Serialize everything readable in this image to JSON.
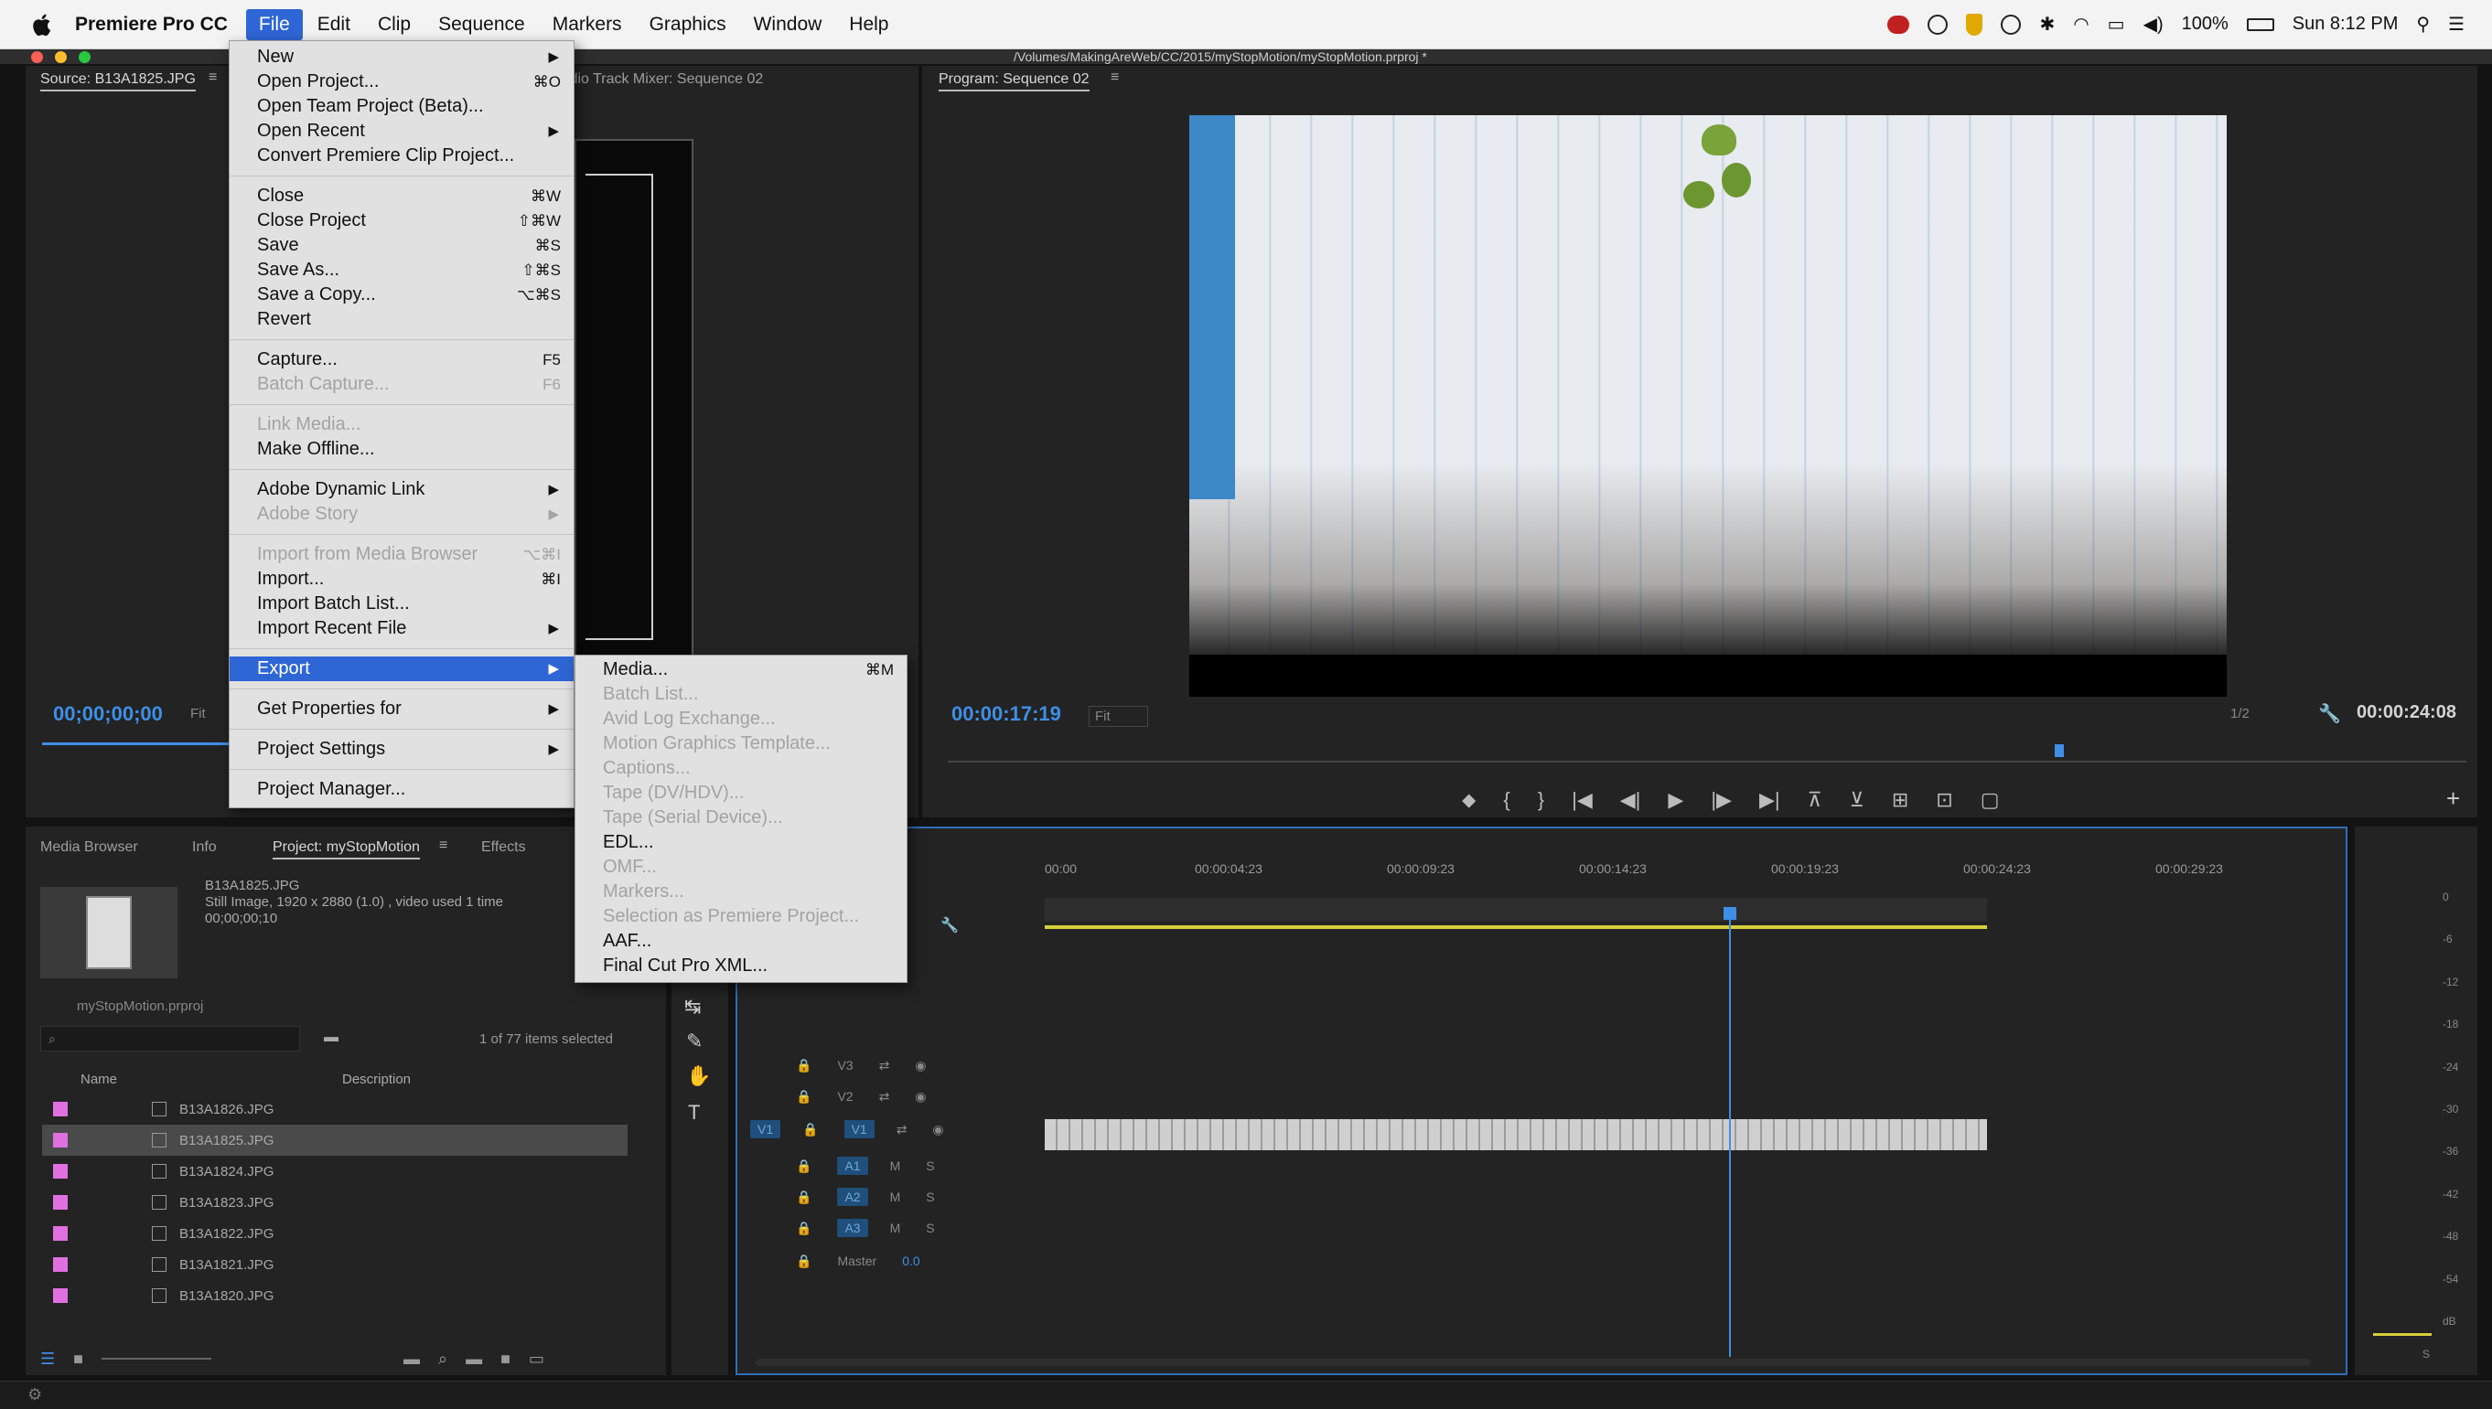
{
  "menubar": {
    "app_name": "Premiere Pro CC",
    "items": [
      "File",
      "Edit",
      "Clip",
      "Sequence",
      "Markers",
      "Graphics",
      "Window",
      "Help"
    ],
    "status": {
      "battery": "100%",
      "clock": "Sun 8:12 PM"
    }
  },
  "window": {
    "path": "/Volumes/MakingAreWeb/CC/2015/myStopMotion/myStopMotion.prproj *"
  },
  "source_panel": {
    "tab_source": "Source: B13A1825.JPG",
    "tab_mixer": "Audio Track Mixer: Sequence 02",
    "timecode": "00;00;00;00",
    "fit": "Fit"
  },
  "program_panel": {
    "tab": "Program: Sequence 02",
    "timecode": "00:00:17:19",
    "fit": "Fit",
    "zoom": "1/2",
    "duration": "00:00:24:08"
  },
  "file_menu": {
    "items": [
      {
        "label": "New",
        "arrow": true
      },
      {
        "label": "Open Project...",
        "shortcut": "⌘O"
      },
      {
        "label": "Open Team Project (Beta)..."
      },
      {
        "label": "Open Recent",
        "arrow": true
      },
      {
        "label": "Convert Premiere Clip Project..."
      },
      {
        "sep": true
      },
      {
        "label": "Close",
        "shortcut": "⌘W"
      },
      {
        "label": "Close Project",
        "shortcut": "⇧⌘W"
      },
      {
        "label": "Save",
        "shortcut": "⌘S"
      },
      {
        "label": "Save As...",
        "shortcut": "⇧⌘S"
      },
      {
        "label": "Save a Copy...",
        "shortcut": "⌥⌘S"
      },
      {
        "label": "Revert"
      },
      {
        "sep": true
      },
      {
        "label": "Capture...",
        "shortcut": "F5"
      },
      {
        "label": "Batch Capture...",
        "shortcut": "F6",
        "disabled": true
      },
      {
        "sep": true
      },
      {
        "label": "Link Media...",
        "disabled": true
      },
      {
        "label": "Make Offline..."
      },
      {
        "sep": true
      },
      {
        "label": "Adobe Dynamic Link",
        "arrow": true
      },
      {
        "label": "Adobe Story",
        "arrow": true,
        "disabled": true
      },
      {
        "sep": true
      },
      {
        "label": "Import from Media Browser",
        "shortcut": "⌥⌘I",
        "disabled": true
      },
      {
        "label": "Import...",
        "shortcut": "⌘I"
      },
      {
        "label": "Import Batch List..."
      },
      {
        "label": "Import Recent File",
        "arrow": true
      },
      {
        "sep": true
      },
      {
        "label": "Export",
        "arrow": true,
        "highlighted": true
      },
      {
        "sep": true
      },
      {
        "label": "Get Properties for",
        "arrow": true
      },
      {
        "sep": true
      },
      {
        "label": "Project Settings",
        "arrow": true
      },
      {
        "sep": true
      },
      {
        "label": "Project Manager..."
      }
    ]
  },
  "export_submenu": {
    "items": [
      {
        "label": "Media...",
        "shortcut": "⌘M"
      },
      {
        "label": "Batch List...",
        "disabled": true
      },
      {
        "label": "Avid Log Exchange...",
        "disabled": true
      },
      {
        "label": "Motion Graphics Template...",
        "disabled": true
      },
      {
        "label": "Captions...",
        "disabled": true
      },
      {
        "label": "Tape (DV/HDV)...",
        "disabled": true
      },
      {
        "label": "Tape (Serial Device)...",
        "disabled": true
      },
      {
        "label": "EDL..."
      },
      {
        "label": "OMF...",
        "disabled": true
      },
      {
        "label": "Markers...",
        "disabled": true
      },
      {
        "label": "Selection as Premiere Project...",
        "disabled": true
      },
      {
        "label": "AAF..."
      },
      {
        "label": "Final Cut Pro XML..."
      }
    ]
  },
  "project_panel": {
    "tabs": [
      "Media Browser",
      "Info",
      "Project: myStopMotion",
      "Effects"
    ],
    "clip_name": "B13A1825.JPG",
    "clip_info": "Still Image, 1920 x 2880 (1.0)  ,  video used 1 time",
    "clip_duration": "00;00;00;10",
    "project_file": "myStopMotion.prproj",
    "selection_count": "1 of 77 items selected",
    "col_name": "Name",
    "col_desc": "Description",
    "files": [
      "B13A1826.JPG",
      "B13A1825.JPG",
      "B13A1824.JPG",
      "B13A1823.JPG",
      "B13A1822.JPG",
      "B13A1821.JPG",
      "B13A1820.JPG"
    ]
  },
  "timeline": {
    "ticks": [
      "00:00",
      "00:00:04:23",
      "00:00:09:23",
      "00:00:14:23",
      "00:00:19:23",
      "00:00:24:23",
      "00:00:29:23"
    ],
    "tracks_video": [
      "V3",
      "V2",
      "V1"
    ],
    "tracks_audio": [
      "A1",
      "A2",
      "A3"
    ],
    "master_label": "Master",
    "master_value": "0.0",
    "v1_source": "V1"
  },
  "meter": {
    "scale": [
      "0",
      "-6",
      "-12",
      "-18",
      "-24",
      "-30",
      "-36",
      "-42",
      "-48",
      "-54",
      "dB"
    ],
    "solo": "S"
  }
}
